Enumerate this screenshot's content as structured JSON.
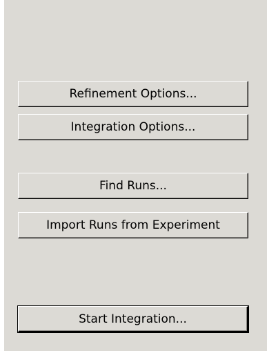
{
  "buttons": {
    "refinement_options": "Refinement Options...",
    "integration_options": "Integration Options...",
    "find_runs": "Find Runs...",
    "import_runs": "Import Runs from Experiment",
    "start_integration": "Start Integration..."
  }
}
